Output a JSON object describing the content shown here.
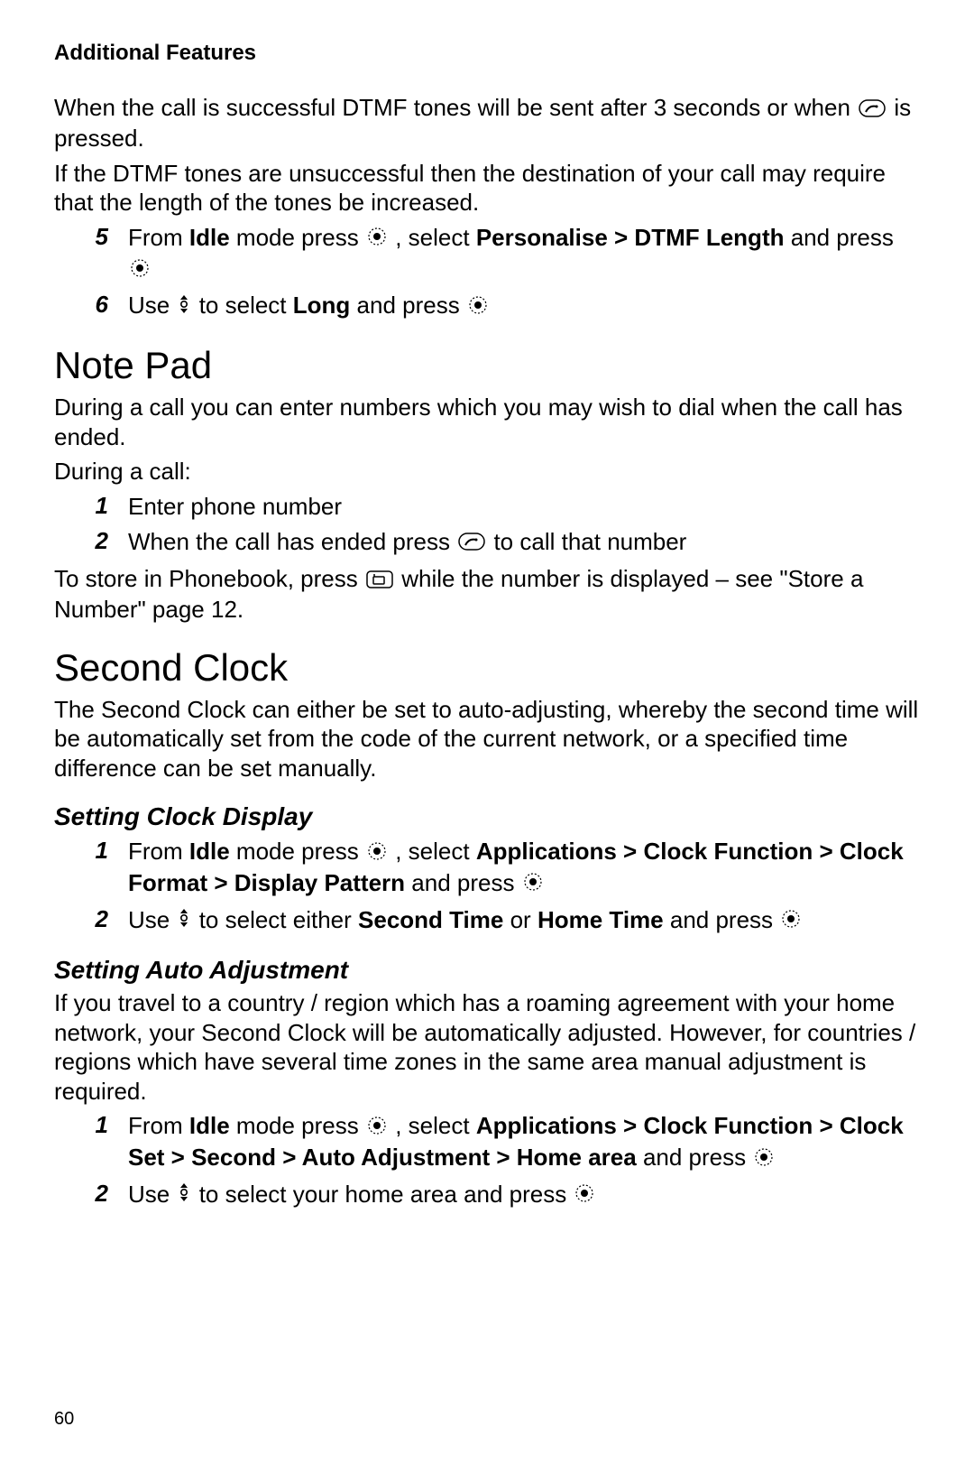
{
  "header": "Additional Features",
  "intro1": "When the call is successful DTMF tones will be sent after 3 seconds or when ",
  "intro1_end": " is pressed.",
  "intro2": "If the DTMF tones are unsuccessful then the destination of your call may require that the length of the tones be increased.",
  "step5": {
    "num": "5",
    "t1": "From ",
    "b1": "Idle",
    "t2": " mode press ",
    "t3": ", select ",
    "b2": "Personalise > DTMF Length",
    "t4": " and press "
  },
  "step6": {
    "num": "6",
    "t1": "Use ",
    "t2": " to select ",
    "b1": "Long",
    "t3": " and press "
  },
  "notepad": {
    "title": "Note Pad",
    "p1": "During a call you can enter numbers which you may wish to dial when the call has ended.",
    "p2": "During a call:",
    "s1": {
      "num": "1",
      "text": "Enter phone number"
    },
    "s2": {
      "num": "2",
      "t1": "When the call has ended press ",
      "t2": " to call that number"
    },
    "p3a": "To store in Phonebook, press ",
    "p3b": " while the number is displayed – see \"Store a Number\" page 12."
  },
  "secondclock": {
    "title": "Second Clock",
    "p1": "The Second Clock can either be set to auto-adjusting, whereby the second time will be automatically set from the code of the current network, or a specified time difference can be set manually.",
    "h_display": "Setting Clock Display",
    "d1": {
      "num": "1",
      "t1": "From ",
      "b1": "Idle",
      "t2": " mode press ",
      "t3": ", select ",
      "b2": "Applications > Clock Function  > Clock Format > Display Pattern",
      "t4": " and press "
    },
    "d2": {
      "num": "2",
      "t1": "Use ",
      "t2": " to select either ",
      "b1": "Second Time",
      "t3": " or ",
      "b2": "Home Time",
      "t4": " and press "
    },
    "h_auto": "Setting Auto Adjustment",
    "auto_p": "If you travel to a country / region which has a roaming agreement with your home network, your Second Clock will be automatically adjusted. However, for countries / regions which have several time zones in the same area manual adjustment is required.",
    "a1": {
      "num": "1",
      "t1": "From ",
      "b1": "Idle",
      "t2": " mode press ",
      "t3": ", select ",
      "b2": "Applications > Clock Function  > Clock Set > Second > Auto Adjustment > Home area",
      "t4": "  and press "
    },
    "a2": {
      "num": "2",
      "t1": "Use ",
      "t2": " to select your home area and press "
    }
  },
  "page_number": "60"
}
